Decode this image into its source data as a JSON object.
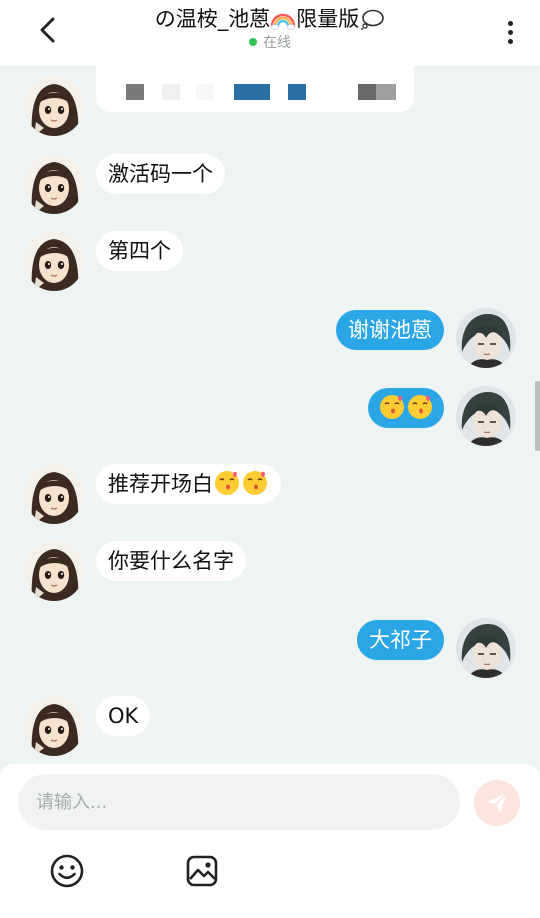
{
  "header": {
    "title": "の温桉_池蒽",
    "title_suffix": "限量版",
    "status": "在线"
  },
  "messages": [
    {
      "side": "left",
      "text": "激活码一个"
    },
    {
      "side": "left",
      "text": "第四个"
    },
    {
      "side": "right",
      "text": "谢谢池蒽"
    },
    {
      "side": "left",
      "text": "推荐开场白"
    },
    {
      "side": "left",
      "text": "你要什么名字"
    },
    {
      "side": "right",
      "text": "大祁子"
    },
    {
      "side": "left",
      "text": "OK"
    }
  ],
  "input": {
    "placeholder": "请输入..."
  },
  "icons": {
    "back": "chevron-left-icon",
    "more": "more-vertical-icon",
    "send": "send-icon",
    "emoji": "smiley-icon",
    "image": "image-icon"
  },
  "colors": {
    "accent": "#2aa6e6",
    "background": "#eef4f3",
    "online": "#35c25a"
  }
}
